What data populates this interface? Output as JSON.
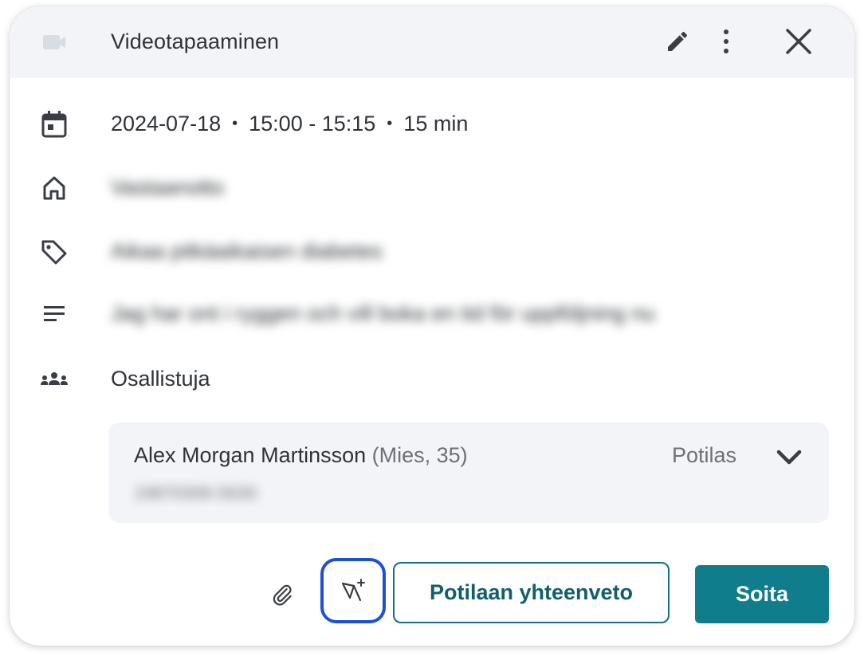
{
  "header": {
    "title": "Videotapaaminen",
    "icons": [
      "video-camera-icon",
      "pencil-icon",
      "more-vertical-icon",
      "close-icon"
    ]
  },
  "details": {
    "date": "2024-07-18",
    "time": "15:00 - 15:15",
    "duration": "15 min",
    "separator": "•",
    "location": "Vastaanotto",
    "category": "Aikaa pitkäaikaisen diabetes",
    "description": "Jag har ont i ryggen och vill boka en tid för uppföljning nu",
    "participants_label": "Osallistuja"
  },
  "participant": {
    "name": "Alex Morgan Martinsson",
    "detail": "(Mies, 35)",
    "role": "Potilas",
    "id": "19870306-5630"
  },
  "footer": {
    "summary_label": "Potilaan yhteenveto",
    "call_label": "Soita"
  },
  "colors": {
    "header_bg": "#f3f4f8",
    "accent": "#0f7d8c",
    "focus_ring": "#1d4fd6"
  }
}
